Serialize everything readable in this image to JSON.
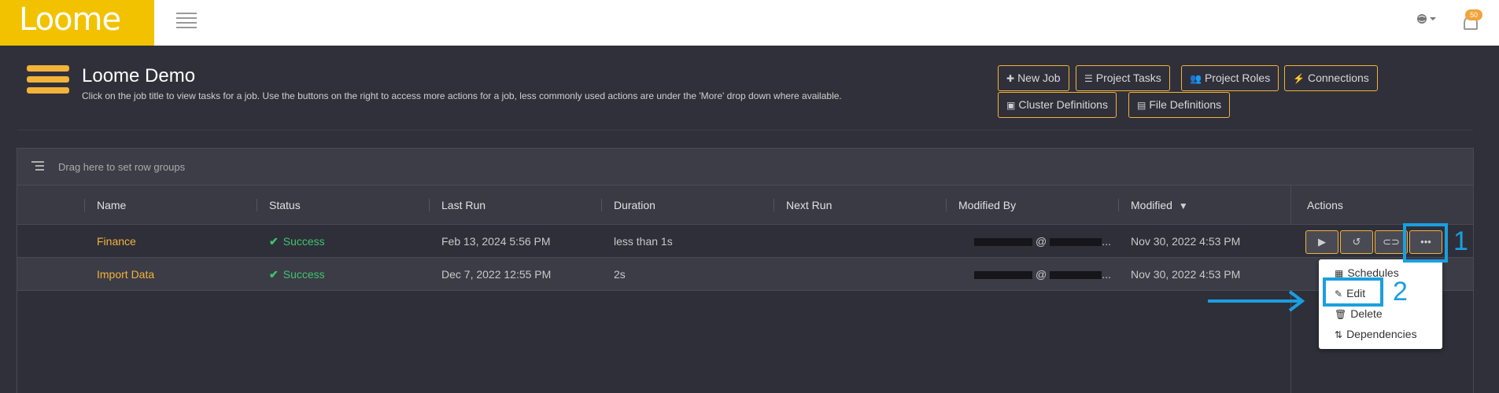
{
  "app": {
    "logo_text": "Loome",
    "notification_count": "50"
  },
  "page": {
    "title": "Loome Demo",
    "subtitle": "Click on the job title to view tasks for a job. Use the buttons on the right to access more actions for a job, less commonly used actions are under the 'More' drop down where available."
  },
  "toolbar": {
    "new_job": "New Job",
    "project_tasks": "Project Tasks",
    "project_roles": "Project Roles",
    "connections": "Connections",
    "cluster_definitions": "Cluster Definitions",
    "file_definitions": "File Definitions"
  },
  "grid": {
    "grouping_placeholder": "Drag here to set row groups",
    "columns": {
      "name": "Name",
      "status": "Status",
      "last_run": "Last Run",
      "duration": "Duration",
      "next_run": "Next Run",
      "modified_by": "Modified By",
      "modified": "Modified",
      "actions": "Actions"
    },
    "rows": [
      {
        "name": "Finance",
        "status": "Success",
        "last_run": "Feb 13, 2024 5:56 PM",
        "duration": "less than 1s",
        "next_run": "",
        "modified_by_at": "@",
        "modified_by_ellipsis": "...",
        "modified": "Nov 30, 2022 4:53 PM"
      },
      {
        "name": "Import Data",
        "status": "Success",
        "last_run": "Dec 7, 2022 12:55 PM",
        "duration": "2s",
        "next_run": "",
        "modified_by_at": "@",
        "modified_by_ellipsis": "...",
        "modified": "Nov 30, 2022 4:53 PM"
      }
    ]
  },
  "more_menu": {
    "items": [
      "Schedules",
      "Edit",
      "Delete",
      "Dependencies"
    ]
  },
  "annotations": {
    "step1": "1",
    "step2": "2"
  },
  "colors": {
    "accent": "#f2b33a",
    "success": "#3ec46d",
    "annotation": "#1a9fe0",
    "logo_bg": "#f2c200"
  }
}
